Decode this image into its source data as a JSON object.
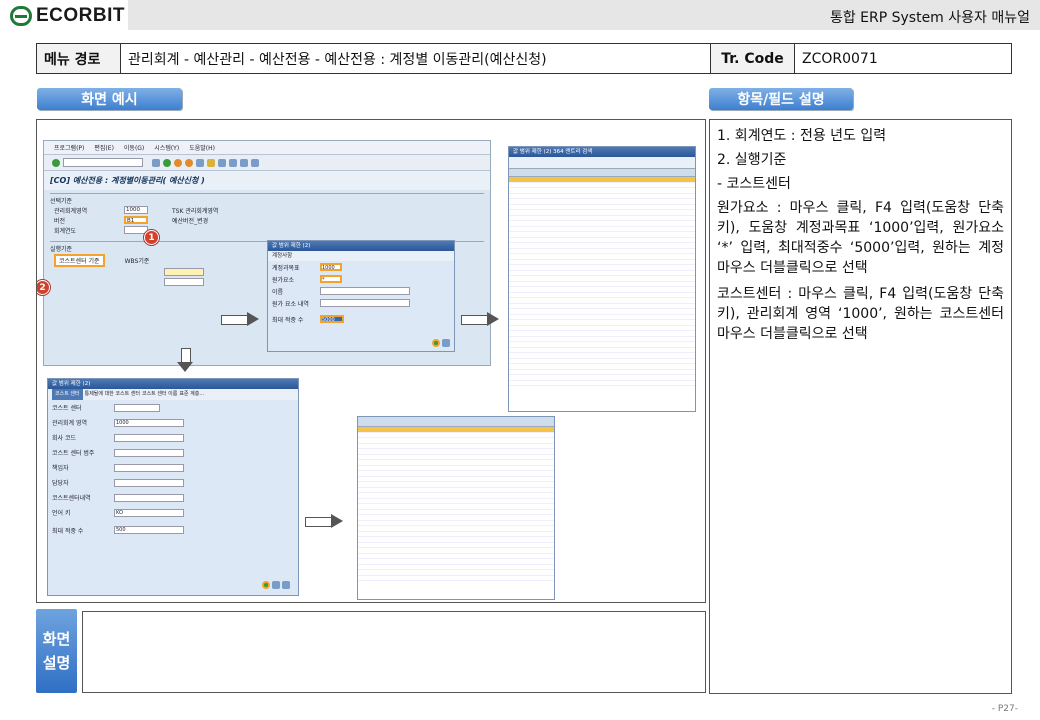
{
  "header": {
    "logo_text": "ECORBIT",
    "manual_title": "통합 ERP System 사용자 매뉴얼"
  },
  "pathbar": {
    "menu_label": "메뉴 경로",
    "menu_path": "관리회계 - 예산관리 - 예산전용 - 예산전용 : 계정별 이동관리(예산신청)",
    "tr_label": "Tr. Code",
    "tr_value": "ZCOR0071"
  },
  "sections": {
    "screen_example": "화면 예시",
    "field_description": "항목/필드 설명",
    "screen_explanation_1": "화면",
    "screen_explanation_2": "설명"
  },
  "descriptions": {
    "item1": "1.  회계연도 : 전용 년도 입력",
    "item2": "2.  실행기준",
    "item2_sub": "  - 코스트센터",
    "para1": "원가요소 : 마우스 클릭, F4 입력(도움창 단축키), 도움창 계정과목표 ‘1000’입력, 원가요소 ‘*’ 입력, 최대적중수 ‘5000’입력, 원하는 계정 마우스 더블클릭으로 선택",
    "para2": "코스트센터 : 마우스 클릭, F4 입력(도움창 단축키), 관리회계 영역 ‘1000’, 원하는 코스트센터 마우스 더블클릭으로 선택"
  },
  "screenshot": {
    "menu_items": [
      "프로그램(P)",
      "편집(E)",
      "이동(G)",
      "시스템(Y)",
      "도움말(H)"
    ],
    "title": "[CO] 예산전용 : 계정별이동관리( 예산신청 )",
    "group1": "선택기준",
    "rows": [
      {
        "label": "관리회계영역",
        "value": "1000",
        "desc": "TSK 관리회계영역"
      },
      {
        "label": "버전",
        "value": "B1",
        "desc": "예산버전_변경"
      },
      {
        "label": "회계연도",
        "value": "",
        "desc": ""
      }
    ],
    "group2": "실행기준",
    "radio1": "코스트센터 기준",
    "radio2": "WBS기준",
    "popup1_title": "값 범위 제한 (2)",
    "popup1_tab": "계정사항",
    "popup1_rows": [
      "계정과목표",
      "원가요소",
      "이름",
      "원가 요소 내역",
      "최대 적중 수"
    ],
    "popup1_values": [
      "1000",
      "*",
      "",
      "",
      "5000"
    ],
    "list_title": "값 범위 제한 (2)  364 엔트리 검색",
    "popup2_title": "값 범위 제한 (2)",
    "popup2_tabs": [
      "코스트 센터",
      "통제될에 대한 코스트 센터",
      "코스트 센터 이름",
      "표준 계층..."
    ],
    "popup2_rows": [
      "코스트 센터",
      "관리회계 영역",
      "회사 코드",
      "코스트 센터 범주",
      "책임자",
      "담당자",
      "코스트센터내역",
      "언어 키",
      "최대 적중 수"
    ],
    "popup2_values": [
      "",
      "1000",
      "",
      "",
      "",
      "",
      "",
      "KO",
      "500"
    ],
    "badge1": "1",
    "badge2": "2"
  },
  "page_number": "- P27-"
}
